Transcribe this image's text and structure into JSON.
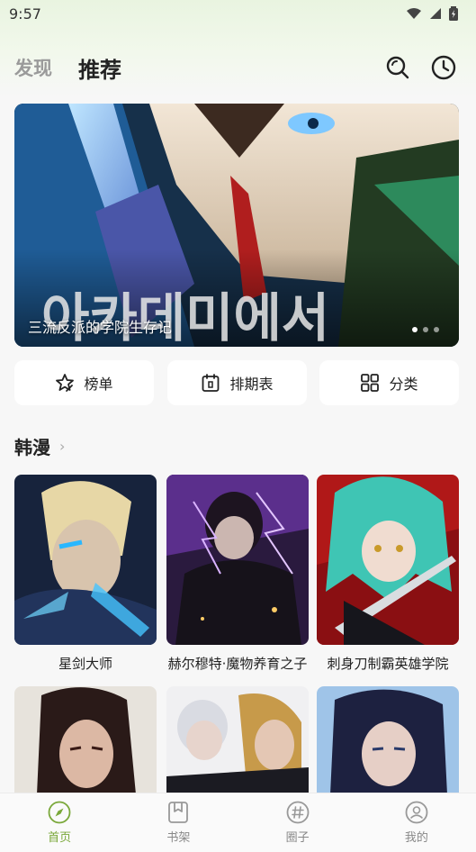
{
  "status_bar": {
    "time": "9:57"
  },
  "header": {
    "tabs": [
      {
        "label": "发现",
        "active": false
      },
      {
        "label": "推荐",
        "active": true
      }
    ],
    "icons": [
      "search-icon",
      "history-icon"
    ]
  },
  "banner": {
    "title": "三流反派的学院生存记",
    "dots": 3,
    "active_dot": 0
  },
  "quick_actions": [
    {
      "label": "榜单",
      "icon": "star-badge-icon"
    },
    {
      "label": "排期表",
      "icon": "calendar-icon"
    },
    {
      "label": "分类",
      "icon": "grid-icon"
    }
  ],
  "section": {
    "title": "韩漫",
    "comics": [
      {
        "title": "星剑大师"
      },
      {
        "title": "赫尔穆特·魔物养育之子"
      },
      {
        "title": "刺身刀制霸英雄学院"
      },
      {
        "title": ""
      },
      {
        "title": ""
      },
      {
        "title": ""
      }
    ]
  },
  "bottom_nav": [
    {
      "label": "首页",
      "icon": "compass-icon",
      "active": true
    },
    {
      "label": "书架",
      "icon": "bookmark-icon",
      "active": false
    },
    {
      "label": "圈子",
      "icon": "hashtag-icon",
      "active": false
    },
    {
      "label": "我的",
      "icon": "user-icon",
      "active": false
    }
  ],
  "colors": {
    "accent": "#7aa83a",
    "background": "#f7f7f7",
    "header_tint": "#e9f4e0"
  }
}
